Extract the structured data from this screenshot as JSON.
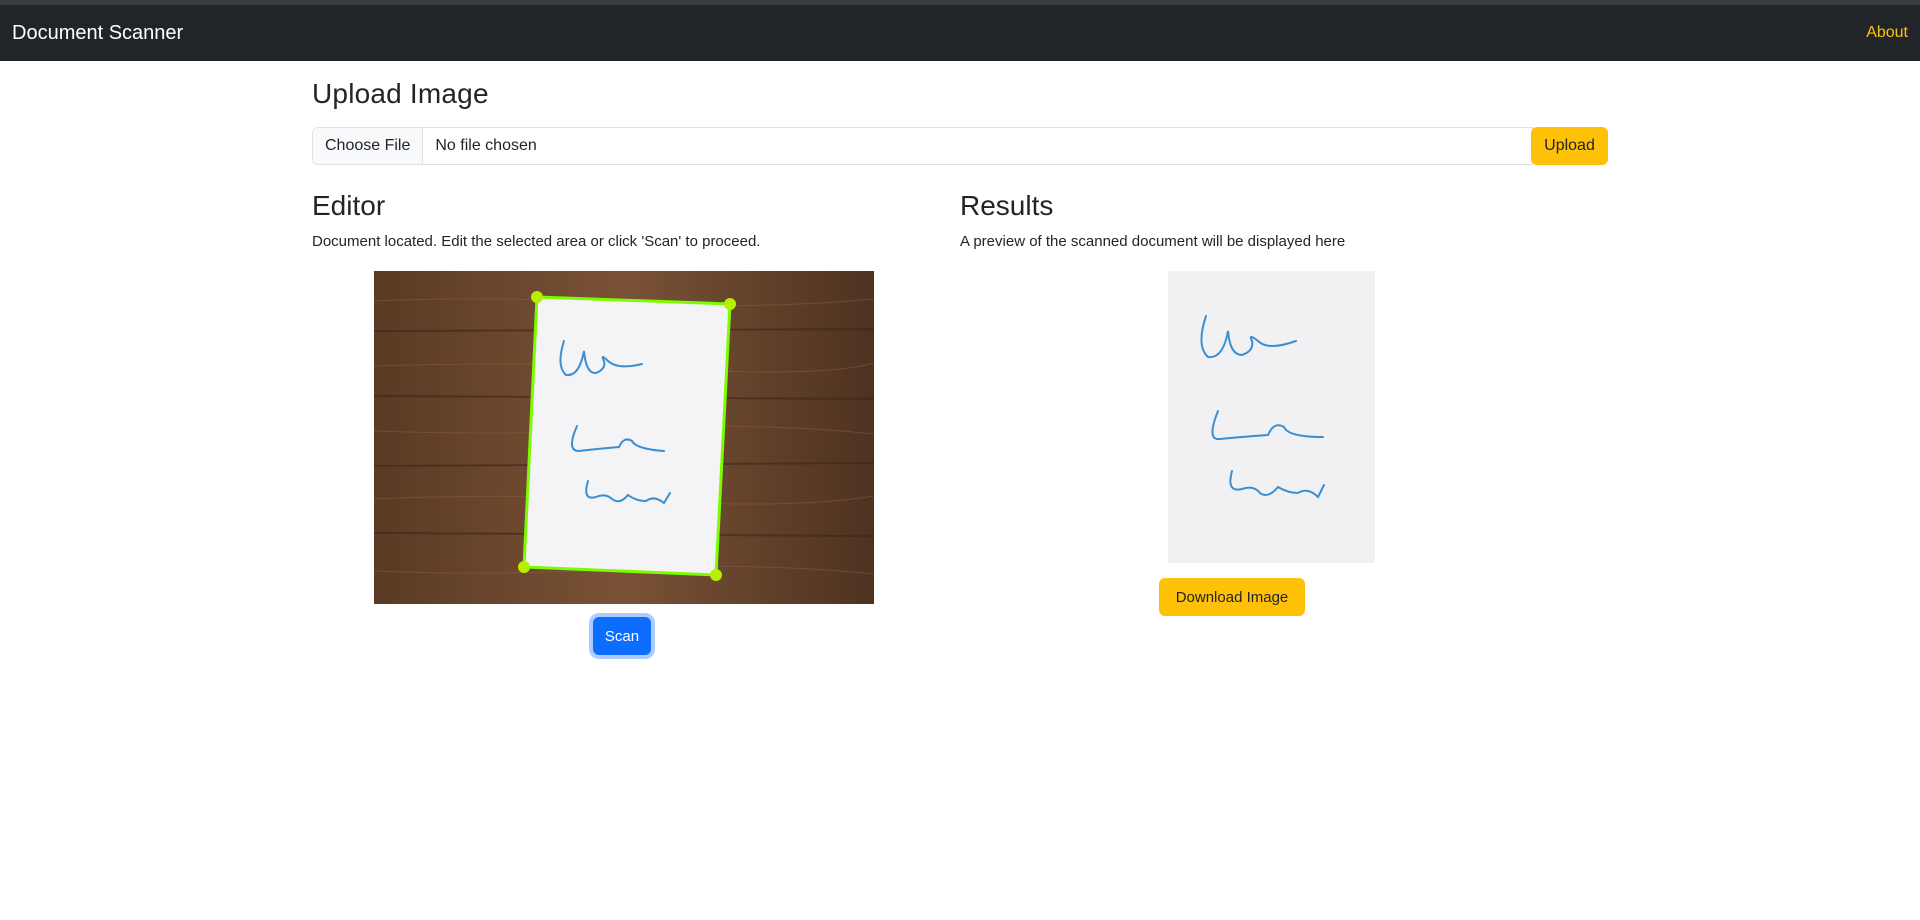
{
  "navbar": {
    "brand": "Document Scanner",
    "about_label": "About",
    "background_color": "#212529",
    "link_color": "#ffc107"
  },
  "upload": {
    "title": "Upload Image",
    "choose_file_label": "Choose File",
    "file_status": "No file chosen",
    "upload_button_label": "Upload"
  },
  "editor": {
    "title": "Editor",
    "description": "Document located. Edit the selected area or click 'Scan' to proceed.",
    "scan_button_label": "Scan",
    "selection_color": "#7cfc00"
  },
  "results": {
    "title": "Results",
    "description": "A preview of the scanned document will be displayed here",
    "download_button_label": "Download Image"
  },
  "colors": {
    "primary": "#0d6efd",
    "warning": "#ffc107",
    "wood": "#6e4a30"
  }
}
